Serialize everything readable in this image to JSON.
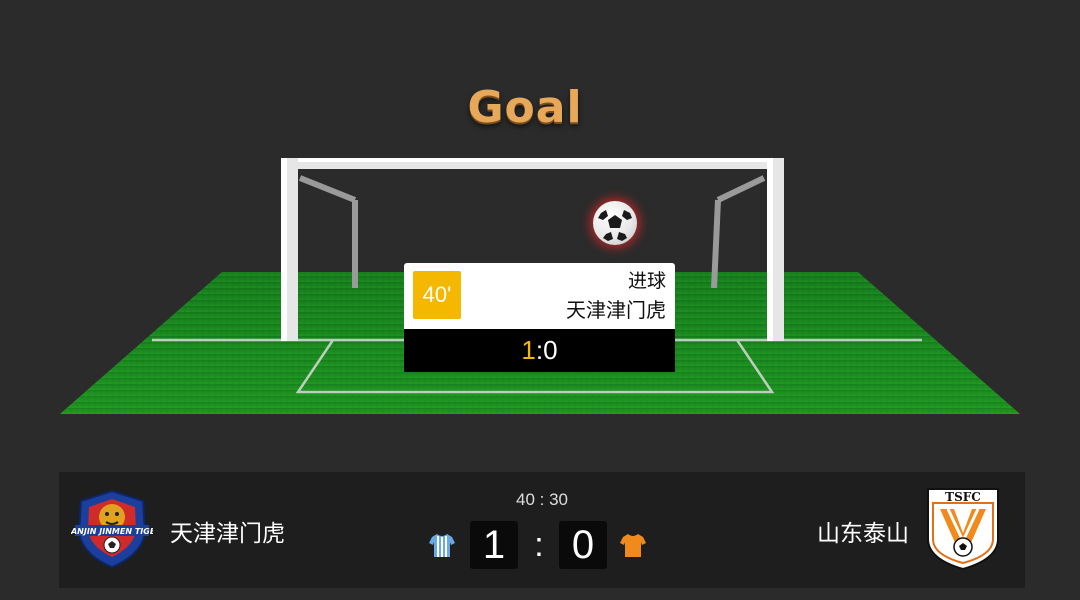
{
  "banner": {
    "title": "Goal"
  },
  "event": {
    "minute": "40'",
    "type": "进球",
    "team": "天津津门虎",
    "score_home": "1",
    "score_away": ":0"
  },
  "match": {
    "clock": "40 : 30",
    "home": {
      "name": "天津津门虎",
      "score": "1",
      "logo_text": "TIANJIN JINMEN TIGER",
      "jersey_color": "#6aa9e6"
    },
    "separator": ":",
    "away": {
      "name": "山东泰山",
      "score": "0",
      "logo_text": "TSFC",
      "jersey_color": "#f08a1d"
    }
  },
  "colors": {
    "background": "#2b2b2b",
    "pitch": "#1f8f1f",
    "accent": "#f5b800",
    "goal_title": "#e7a85a"
  }
}
